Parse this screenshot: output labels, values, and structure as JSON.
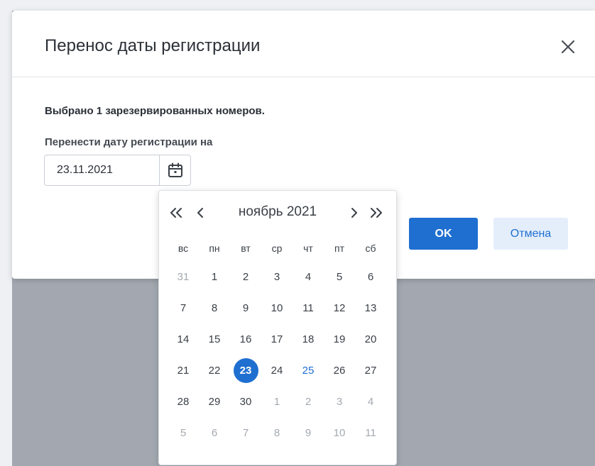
{
  "dialog": {
    "title": "Перенос даты регистрации",
    "message": "Выбрано 1 зарезервированных номеров.",
    "date_label": "Перенести дату регистрации на",
    "date_value": "23.11.2021",
    "ok_label": "OK",
    "cancel_label": "Отмена"
  },
  "calendar": {
    "month_label": "ноябрь 2021",
    "weekdays": [
      "вс",
      "пн",
      "вт",
      "ср",
      "чт",
      "пт",
      "сб"
    ],
    "weeks": [
      [
        {
          "d": "31",
          "o": true
        },
        {
          "d": "1"
        },
        {
          "d": "2"
        },
        {
          "d": "3"
        },
        {
          "d": "4"
        },
        {
          "d": "5"
        },
        {
          "d": "6"
        }
      ],
      [
        {
          "d": "7"
        },
        {
          "d": "8"
        },
        {
          "d": "9"
        },
        {
          "d": "10"
        },
        {
          "d": "11"
        },
        {
          "d": "12"
        },
        {
          "d": "13"
        }
      ],
      [
        {
          "d": "14"
        },
        {
          "d": "15"
        },
        {
          "d": "16"
        },
        {
          "d": "17"
        },
        {
          "d": "18"
        },
        {
          "d": "19"
        },
        {
          "d": "20"
        }
      ],
      [
        {
          "d": "21"
        },
        {
          "d": "22"
        },
        {
          "d": "23",
          "sel": true
        },
        {
          "d": "24"
        },
        {
          "d": "25",
          "today": true
        },
        {
          "d": "26"
        },
        {
          "d": "27"
        }
      ],
      [
        {
          "d": "28"
        },
        {
          "d": "29"
        },
        {
          "d": "30"
        },
        {
          "d": "1",
          "o": true
        },
        {
          "d": "2",
          "o": true
        },
        {
          "d": "3",
          "o": true
        },
        {
          "d": "4",
          "o": true
        }
      ],
      [
        {
          "d": "5",
          "o": true
        },
        {
          "d": "6",
          "o": true
        },
        {
          "d": "7",
          "o": true
        },
        {
          "d": "8",
          "o": true
        },
        {
          "d": "9",
          "o": true
        },
        {
          "d": "10",
          "o": true
        },
        {
          "d": "11",
          "o": true
        }
      ]
    ]
  },
  "icons": {
    "close": "close-icon",
    "calendar": "calendar-icon",
    "prev_year": "double-chevron-left-icon",
    "prev_month": "chevron-left-icon",
    "next_month": "chevron-right-icon",
    "next_year": "double-chevron-right-icon"
  },
  "colors": {
    "accent": "#1f6fd0",
    "today": "#1f6fd0",
    "overlay": "#a3a8b0",
    "muted_day": "#a4a9b0"
  }
}
